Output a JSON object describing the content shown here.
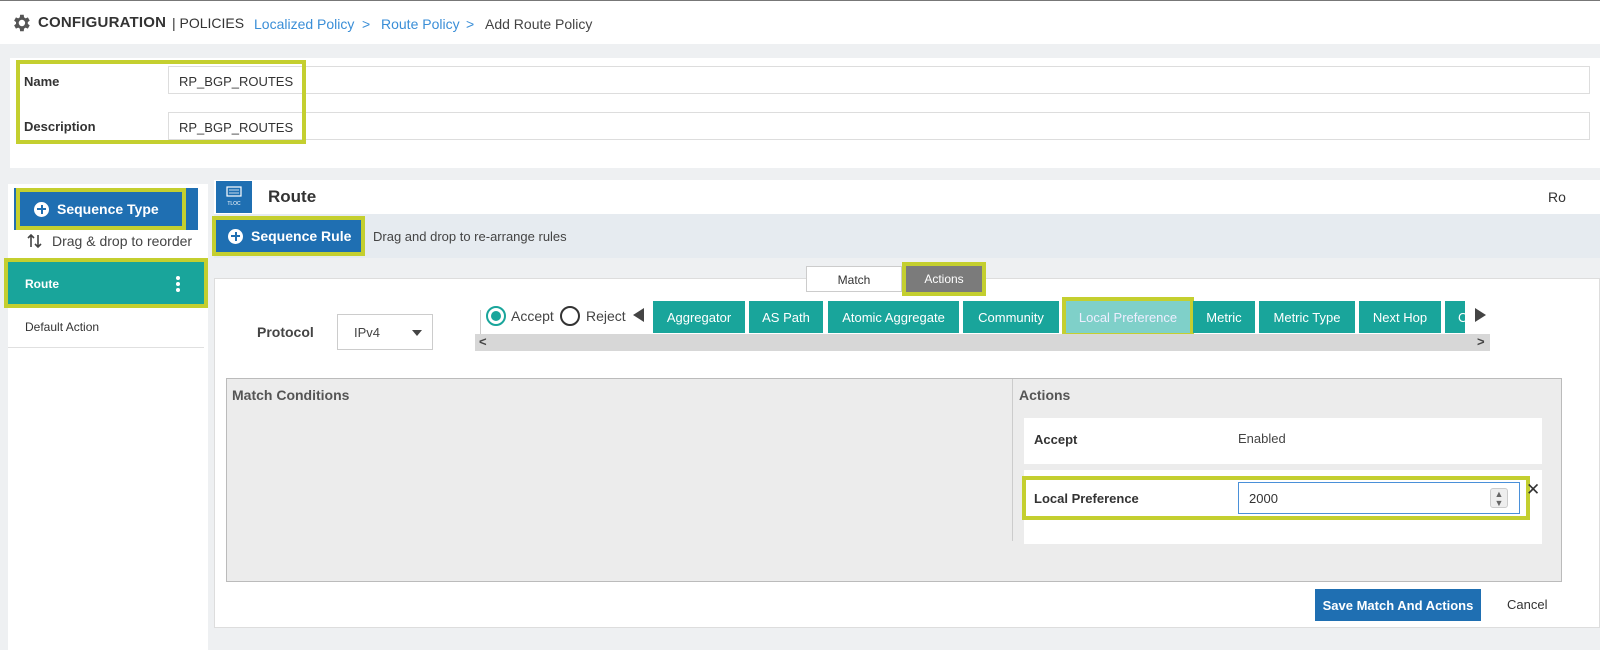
{
  "header": {
    "title": "CONFIGURATION",
    "section": "| POLICIES",
    "breadcrumb": [
      {
        "label": "Localized Policy",
        "link": true
      },
      {
        "label": ">",
        "link": false
      },
      {
        "label": "Route Policy",
        "link": true
      },
      {
        "label": ">",
        "link": false
      },
      {
        "label": "Add Route Policy",
        "link": false
      }
    ]
  },
  "policy": {
    "name_label": "Name",
    "name_value": "RP_BGP_ROUTES",
    "description_label": "Description",
    "description_value": "RP_BGP_ROUTES"
  },
  "sidebar": {
    "sequence_type_button": "Sequence Type",
    "drag_hint": "Drag & drop to reorder",
    "items": [
      {
        "label": "Route",
        "active": true
      },
      {
        "label": "Default Action",
        "active": false
      }
    ]
  },
  "route_panel": {
    "title": "Route",
    "right_text": "Ro",
    "icon_caption": "TLOC",
    "sequence_rule_button": "Sequence Rule",
    "rule_hint": "Drag and drop to re-arrange rules",
    "tabs": [
      {
        "label": "Match",
        "active": false
      },
      {
        "label": "Actions",
        "active": true
      }
    ],
    "protocol_label": "Protocol",
    "protocol_value": "IPv4",
    "radio_accept": "Accept",
    "radio_reject": "Reject",
    "selected_radio": "Accept",
    "action_buttons": [
      {
        "label": "Aggregator"
      },
      {
        "label": "AS Path"
      },
      {
        "label": "Atomic Aggregate"
      },
      {
        "label": "Community"
      },
      {
        "label": "Local Preference",
        "selected": true
      },
      {
        "label": "Metric"
      },
      {
        "label": "Metric Type"
      },
      {
        "label": "Next Hop"
      },
      {
        "label": "C"
      }
    ],
    "scroll_left": "<",
    "scroll_right": ">",
    "match_conditions_title": "Match Conditions",
    "actions_title": "Actions",
    "actions_rows": [
      {
        "label": "Accept",
        "value": "Enabled"
      },
      {
        "label": "Local Preference",
        "value": "2000"
      }
    ],
    "close_symbol": "✕",
    "save_button": "Save Match And Actions",
    "cancel_button": "Cancel"
  },
  "colors": {
    "primary_blue": "#1f6fb2",
    "teal": "#19a59b",
    "teal_selected": "#7fd0c9",
    "highlight": "#c4cf2f",
    "link": "#3a8ed7"
  }
}
